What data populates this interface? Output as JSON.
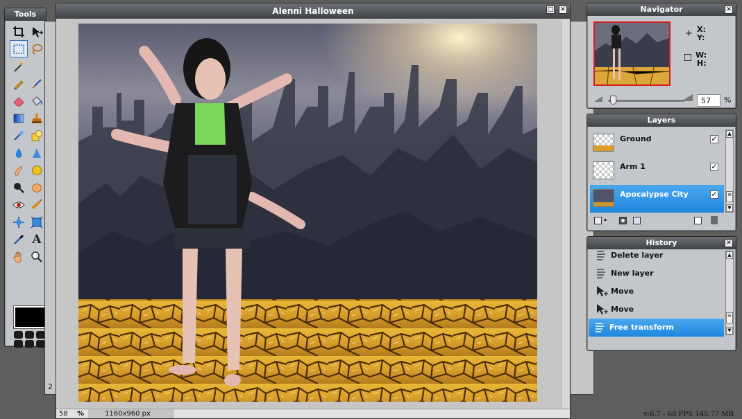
{
  "tools": {
    "title": "Tools",
    "items": [
      "crop",
      "move",
      "marquee",
      "lasso",
      "wand",
      "pencil",
      "brush",
      "eraser",
      "bucket",
      "gradient",
      "stamp",
      "replace",
      "shapes",
      "drop",
      "sharpen",
      "smudge",
      "sponge",
      "zoom-burn",
      "dodge",
      "redeye",
      "bloat",
      "pinch",
      "spherize",
      "eyedropper",
      "type",
      "hand",
      "zoom"
    ],
    "primary_color": "#000000"
  },
  "document": {
    "title": "Alenni Halloween",
    "zoom_value": "58",
    "zoom_unit": "%",
    "size_text": "1160x960 px",
    "partial_label": "2"
  },
  "navigator": {
    "title": "Navigator",
    "x_label": "X:",
    "y_label": "Y:",
    "w_label": "W:",
    "h_label": "H:",
    "zoom": "57",
    "zoom_unit": "%",
    "zoom_level": 0.07
  },
  "layers": {
    "title": "Layers",
    "items": [
      {
        "name": "Ground",
        "visible": true,
        "selected": false
      },
      {
        "name": "Arm 1",
        "visible": true,
        "selected": false
      },
      {
        "name": "Apocalypse City",
        "visible": true,
        "selected": true
      }
    ]
  },
  "history": {
    "title": "History",
    "items": [
      {
        "label": "Delete layer",
        "selected": false
      },
      {
        "label": "New layer",
        "selected": false
      },
      {
        "label": "Move",
        "selected": false
      },
      {
        "label": "Move",
        "selected": false
      },
      {
        "label": "Free transform",
        "selected": true
      }
    ]
  },
  "status": {
    "version": "v:6.7 - 60 FPS 145.77 MB"
  },
  "colors": {
    "accent": "#2a8ae0",
    "selected_border": "#d51d1d",
    "panel_bg": "#c3c7cb"
  }
}
